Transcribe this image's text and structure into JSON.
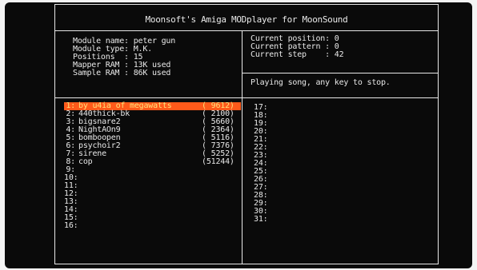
{
  "app": {
    "title": "Moonsoft's Amiga MODplayer for MoonSound"
  },
  "module_info": [
    {
      "label": "Module name:",
      "value": "peter gun"
    },
    {
      "label": "Module type:",
      "value": "M.K."
    },
    {
      "label": "Positions  :",
      "value": "15"
    },
    {
      "label": "Mapper RAM :",
      "value": "13K used"
    },
    {
      "label": "Sample RAM :",
      "value": "86K used"
    }
  ],
  "playback": [
    {
      "label": "Current position:",
      "value": "0"
    },
    {
      "label": "Current pattern :",
      "value": "0"
    },
    {
      "label": "Current step    :",
      "value": "42"
    }
  ],
  "status_text": "Playing song, any key to stop.",
  "samples_left": [
    {
      "num": "1:",
      "name": "by u4ia of megawatts",
      "size": "( 9612)"
    },
    {
      "num": "2:",
      "name": "440thick-bk",
      "size": "( 2100)"
    },
    {
      "num": "3:",
      "name": "bigsnare2",
      "size": "( 5660)"
    },
    {
      "num": "4:",
      "name": "NightAOn9",
      "size": "( 2364)"
    },
    {
      "num": "5:",
      "name": "bomboopen",
      "size": "( 5116)"
    },
    {
      "num": "6:",
      "name": "psychoir2",
      "size": "( 7376)"
    },
    {
      "num": "7:",
      "name": "sirene",
      "size": "( 5252)"
    },
    {
      "num": "8:",
      "name": "cop",
      "size": "(51244)"
    },
    {
      "num": "9:",
      "name": "",
      "size": ""
    },
    {
      "num": "10:",
      "name": "",
      "size": ""
    },
    {
      "num": "11:",
      "name": "",
      "size": ""
    },
    {
      "num": "12:",
      "name": "",
      "size": ""
    },
    {
      "num": "13:",
      "name": "",
      "size": ""
    },
    {
      "num": "14:",
      "name": "",
      "size": ""
    },
    {
      "num": "15:",
      "name": "",
      "size": ""
    },
    {
      "num": "16:",
      "name": "",
      "size": ""
    }
  ],
  "samples_right": [
    "17:",
    "18:",
    "19:",
    "20:",
    "21:",
    "22:",
    "23:",
    "24:",
    "25:",
    "26:",
    "27:",
    "28:",
    "29:",
    "30:",
    "31:"
  ],
  "colors": {
    "highlight_bg": "#ff5a1a",
    "highlight_text": "#ffe27a",
    "text": "#e9e9e9",
    "screen_bg": "#0a0a0a"
  }
}
